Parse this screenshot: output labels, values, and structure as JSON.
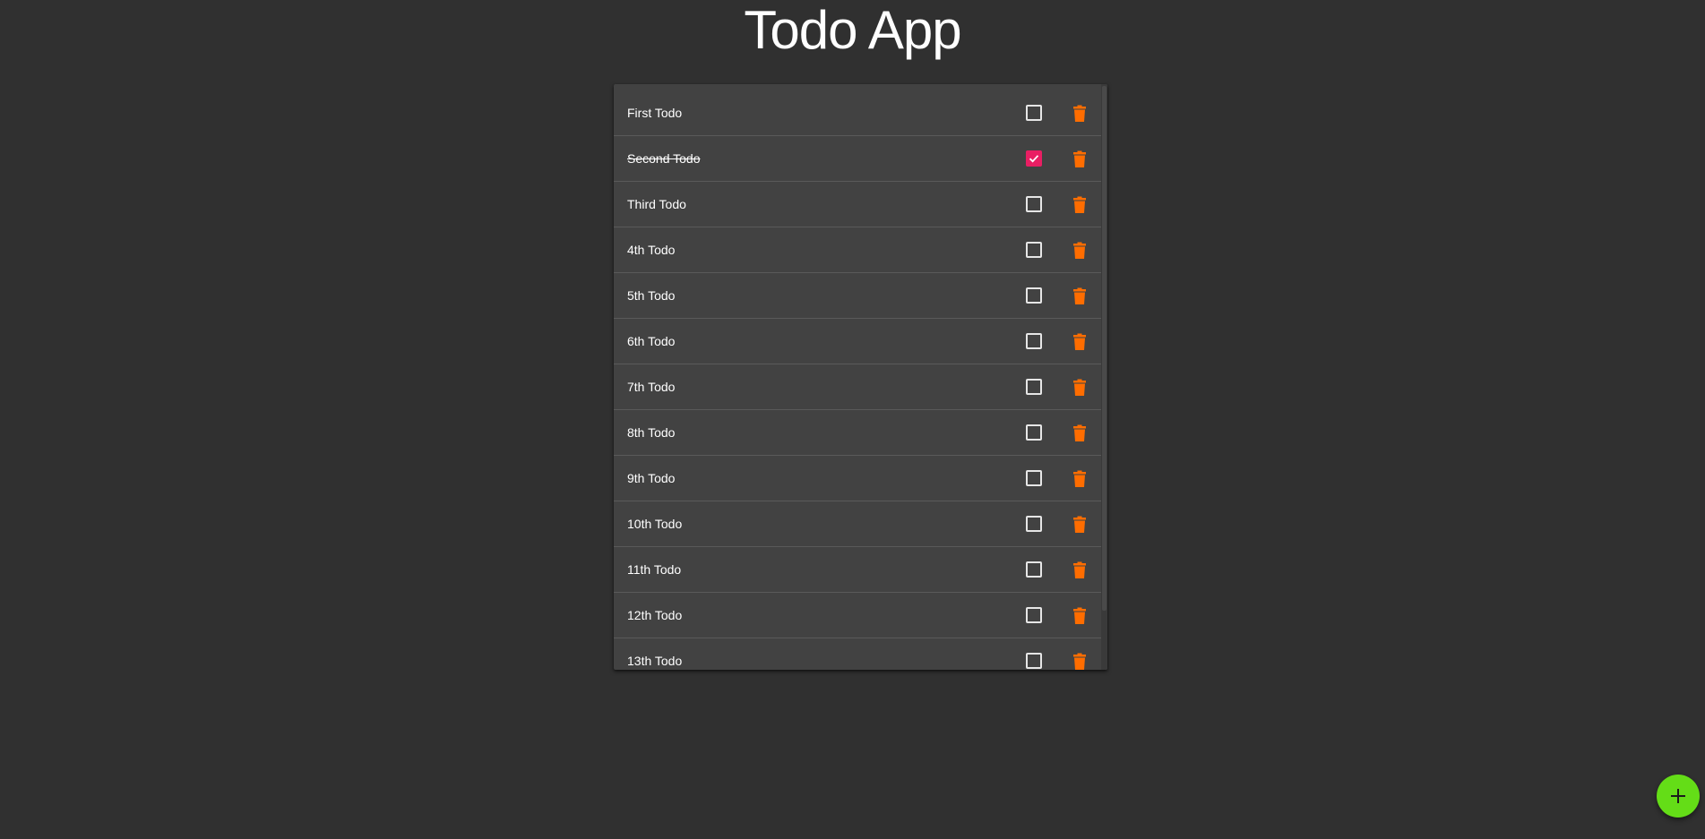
{
  "app": {
    "title": "Todo App"
  },
  "todos": [
    {
      "label": "First Todo",
      "completed": false
    },
    {
      "label": "Second Todo",
      "completed": true
    },
    {
      "label": "Third Todo",
      "completed": false
    },
    {
      "label": "4th Todo",
      "completed": false
    },
    {
      "label": "5th Todo",
      "completed": false
    },
    {
      "label": "6th Todo",
      "completed": false
    },
    {
      "label": "7th Todo",
      "completed": false
    },
    {
      "label": "8th Todo",
      "completed": false
    },
    {
      "label": "9th Todo",
      "completed": false
    },
    {
      "label": "10th Todo",
      "completed": false
    },
    {
      "label": "11th Todo",
      "completed": false
    },
    {
      "label": "12th Todo",
      "completed": false
    },
    {
      "label": "13th Todo",
      "completed": false
    }
  ],
  "icons": {
    "delete": "trash-icon",
    "add": "plus-icon",
    "check": "check-icon"
  },
  "colors": {
    "background": "#303030",
    "card": "#424242",
    "checked": "#e91e63",
    "delete": "#ff6d00",
    "fab": "#64dd17"
  }
}
